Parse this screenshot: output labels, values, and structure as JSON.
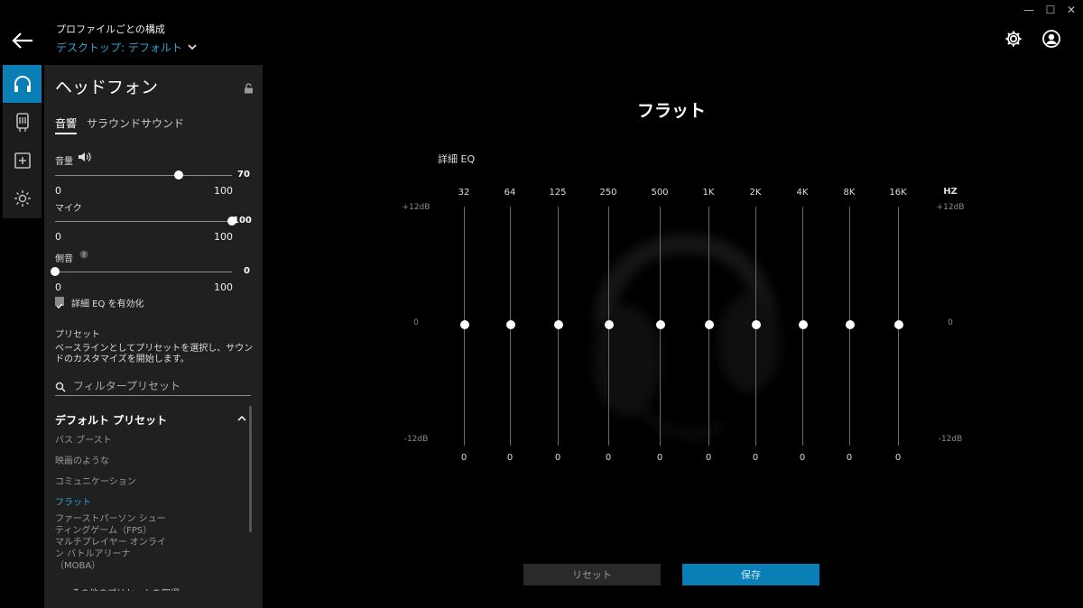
{
  "window": {
    "minimize": "—",
    "maximize": "☐",
    "close": "✕"
  },
  "header": {
    "profile_title": "プロファイルごとの構成",
    "profile_value": "デスクトップ: デフォルト"
  },
  "panel": {
    "title": "ヘッドフォン",
    "tabs": [
      {
        "label": "音響"
      },
      {
        "label": "サラウンドサウンド"
      }
    ],
    "volume": {
      "label": "音量",
      "value": "70",
      "level": 70,
      "min": "0",
      "max": "100"
    },
    "mic": {
      "label": "マイク",
      "value": "100",
      "level": 100,
      "min": "0",
      "max": "100"
    },
    "sidetone": {
      "label": "側音",
      "value": "0",
      "level": 0,
      "min": "0",
      "max": "100"
    },
    "eq_checkbox": {
      "label": "詳細 EQ を有効化",
      "checked": true
    },
    "preset_heading": "プリセット",
    "preset_description": "ベースラインとしてプリセットを選択し、サウンドのカスタマイズを開始します。",
    "filter_placeholder": "フィルタープリセット",
    "default_presets_heading": "デフォルト プリセット",
    "presets": [
      {
        "label": "バス ブースト"
      },
      {
        "label": "映画のような"
      },
      {
        "label": "コミュニケーション"
      },
      {
        "label": "フラット",
        "active": true
      },
      {
        "label": "ファーストパーソン シューティングゲーム（FPS）"
      },
      {
        "label": "マルチプレイヤー オンライン バトルアリーナ（MOBA）"
      }
    ],
    "cut_text": "その他のプリセットを取得"
  },
  "main": {
    "title": "フラット",
    "eq_label": "詳細 EQ",
    "hz_label": "HZ",
    "db_top": "+12dB",
    "db_mid": "0",
    "db_bottom": "-12dB",
    "bands": [
      {
        "freq": "32",
        "value": "0"
      },
      {
        "freq": "64",
        "value": "0"
      },
      {
        "freq": "125",
        "value": "0"
      },
      {
        "freq": "250",
        "value": "0"
      },
      {
        "freq": "500",
        "value": "0"
      },
      {
        "freq": "1K",
        "value": "0"
      },
      {
        "freq": "2K",
        "value": "0"
      },
      {
        "freq": "4K",
        "value": "0"
      },
      {
        "freq": "8K",
        "value": "0"
      },
      {
        "freq": "16K",
        "value": "0"
      }
    ],
    "reset_label": "リセット",
    "save_label": "保存"
  },
  "colors": {
    "accent": "#0a7fb5",
    "link": "#2fa4d8",
    "panel": "#202020"
  }
}
